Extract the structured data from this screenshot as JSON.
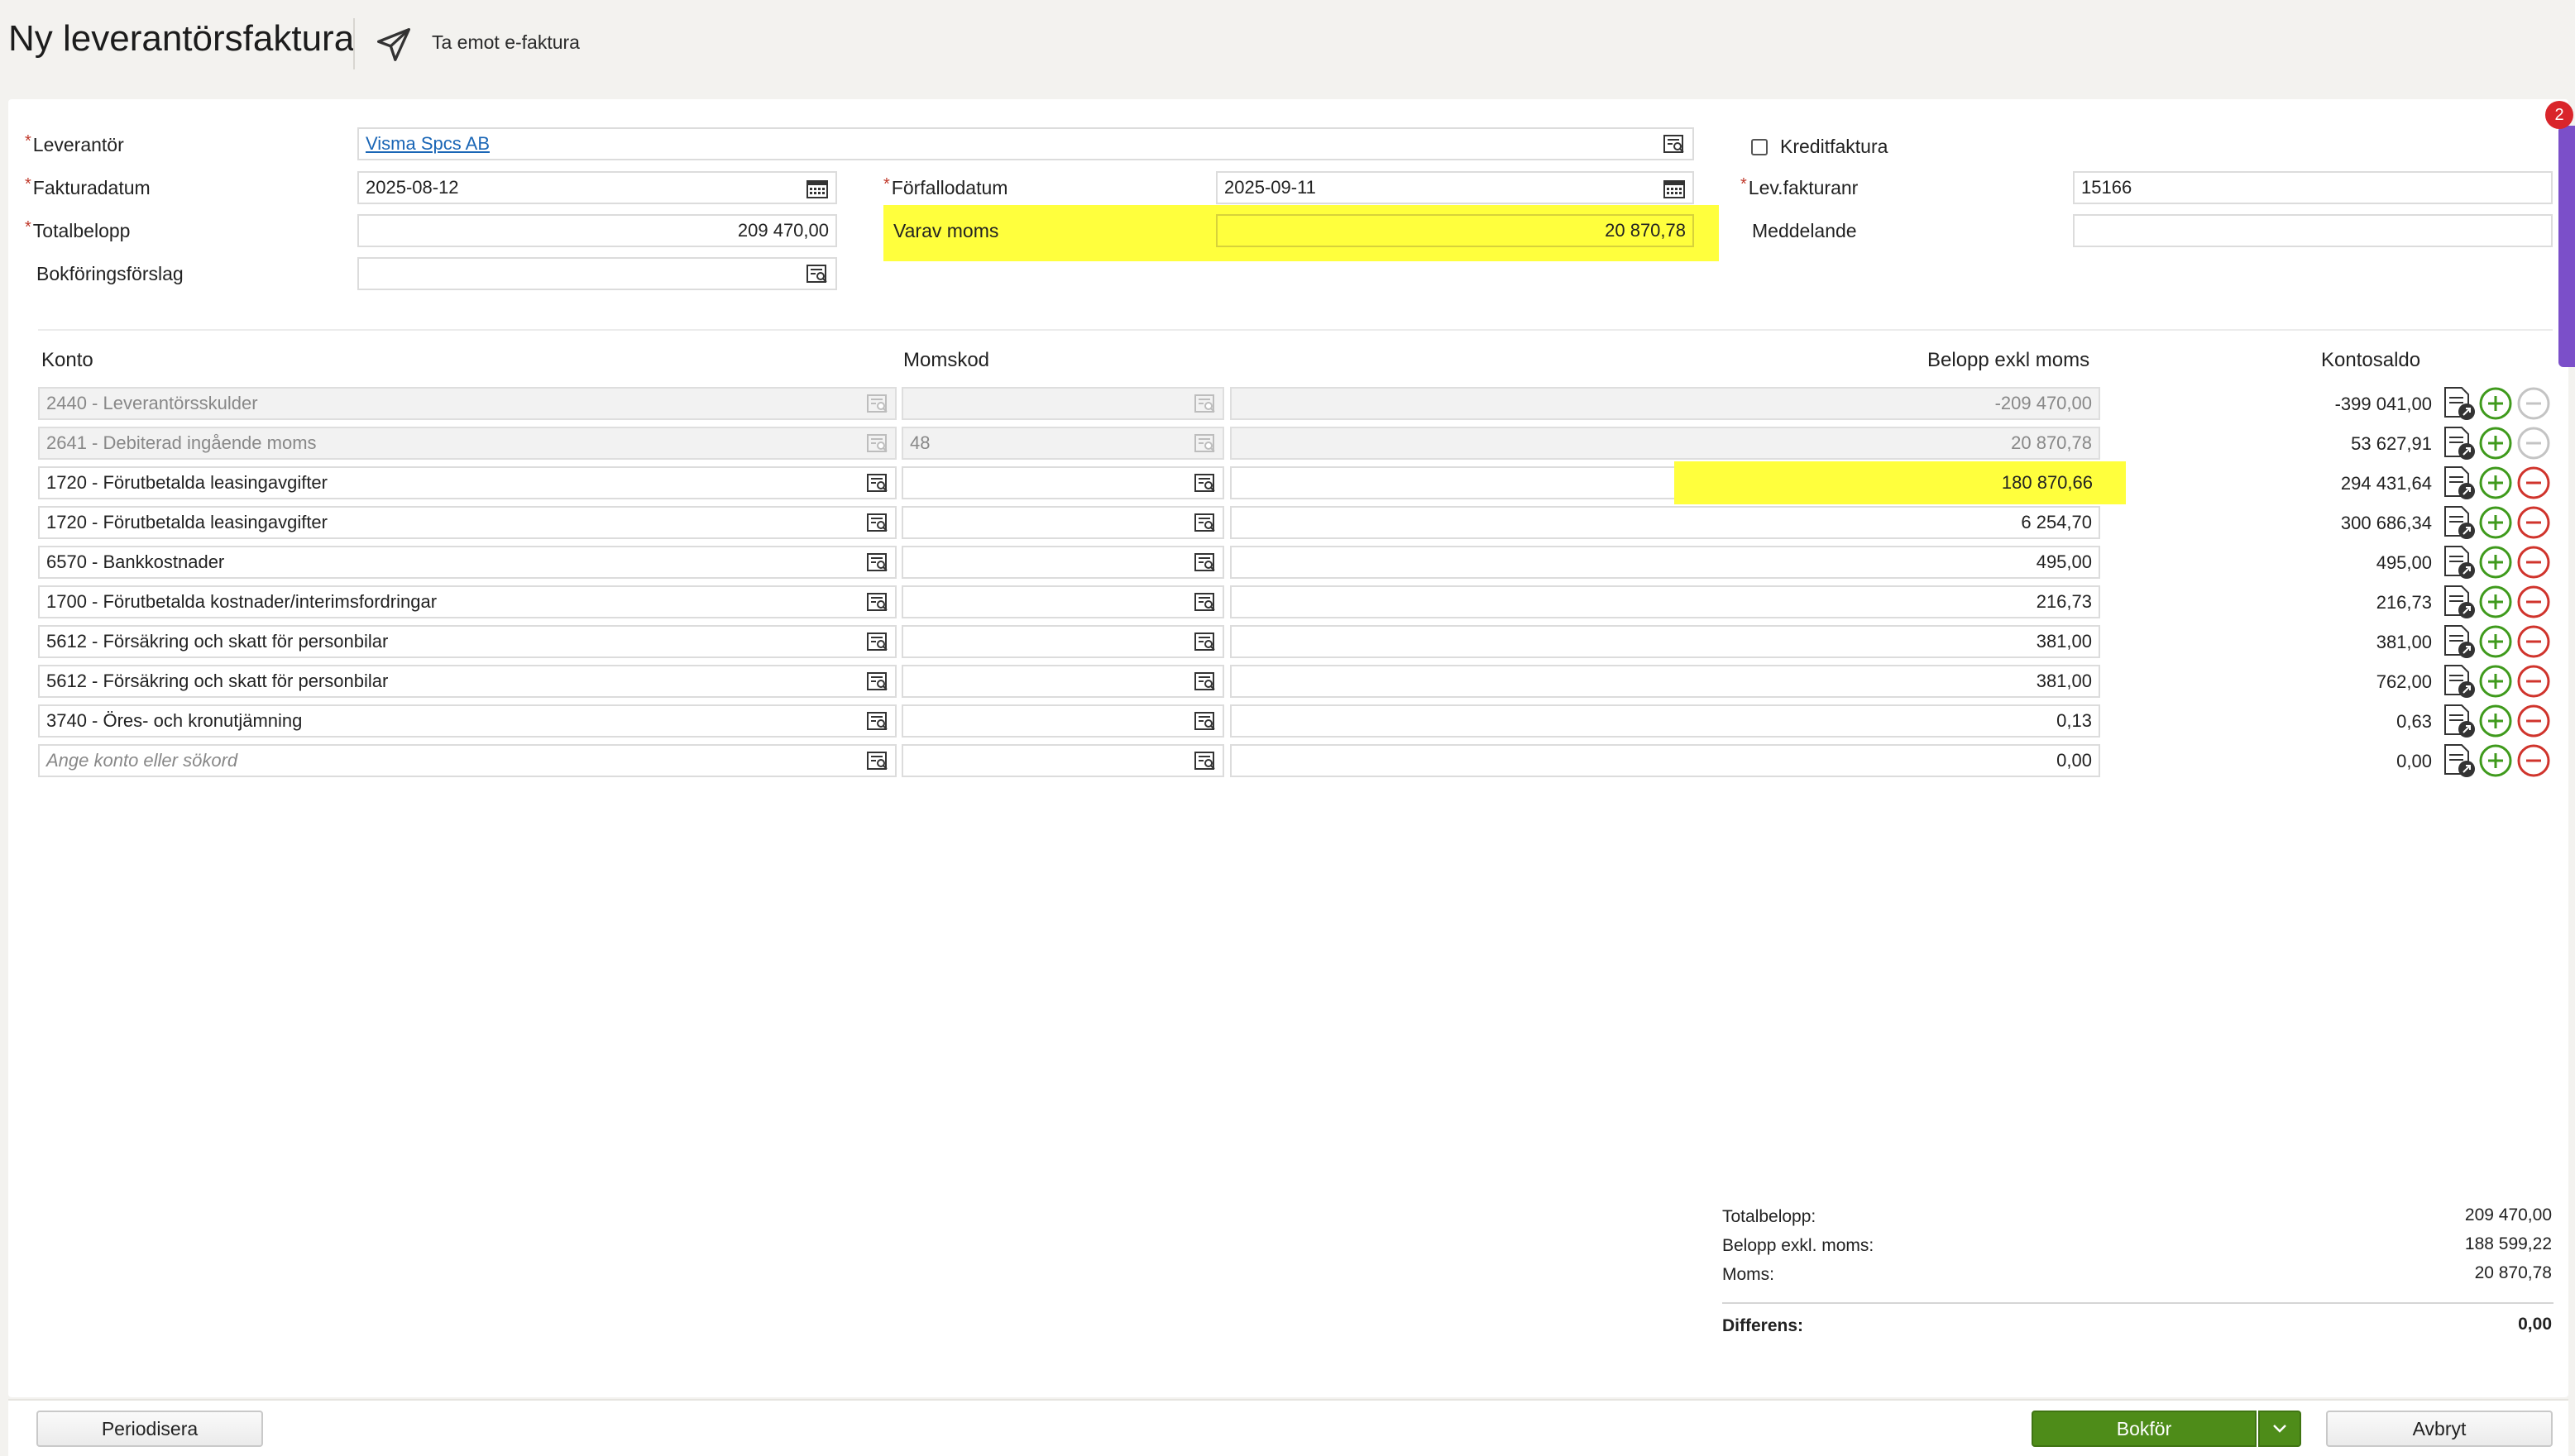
{
  "header": {
    "title": "Ny leverantörsfaktura",
    "receive_einvoice": "Ta emot e-faktura"
  },
  "form": {
    "supplier": {
      "label": "Leverantör",
      "value": "Visma Spcs AB"
    },
    "credit_invoice": {
      "label": "Kreditfaktura",
      "checked": false
    },
    "invoice_date": {
      "label": "Fakturadatum",
      "value": "2025-08-12"
    },
    "due_date": {
      "label": "Förfallodatum",
      "value": "2025-09-11"
    },
    "supplier_invoice_no": {
      "label": "Lev.fakturanr",
      "value": "15166"
    },
    "total_amount": {
      "label": "Totalbelopp",
      "value": "209 470,00"
    },
    "vat_amount": {
      "label": "Varav moms",
      "value": "20 870,78"
    },
    "message": {
      "label": "Meddelande",
      "value": ""
    },
    "booking_proposal": {
      "label": "Bokföringsförslag",
      "value": ""
    },
    "required_mark": "*"
  },
  "table": {
    "headers": {
      "account": "Konto",
      "vat_code": "Momskod",
      "amount_excl_vat": "Belopp exkl moms",
      "account_balance": "Kontosaldo"
    },
    "rows": [
      {
        "account": "2440 - Leverantörsskulder",
        "vat_code": "",
        "amount": "-209 470,00",
        "balance": "-399 041,00",
        "disabled": true
      },
      {
        "account": "2641 - Debiterad ingående moms",
        "vat_code": "48",
        "amount": "20 870,78",
        "balance": "53 627,91",
        "disabled": true
      },
      {
        "account": "1720 - Förutbetalda leasingavgifter",
        "vat_code": "",
        "amount": "180 870,66",
        "balance": "294 431,64",
        "disabled": false,
        "highlight": true
      },
      {
        "account": "1720 - Förutbetalda leasingavgifter",
        "vat_code": "",
        "amount": "6 254,70",
        "balance": "300 686,34",
        "disabled": false
      },
      {
        "account": "6570 - Bankkostnader",
        "vat_code": "",
        "amount": "495,00",
        "balance": "495,00",
        "disabled": false
      },
      {
        "account": "1700 - Förutbetalda kostnader/interimsfordringar",
        "vat_code": "",
        "amount": "216,73",
        "balance": "216,73",
        "disabled": false
      },
      {
        "account": "5612 - Försäkring och skatt för personbilar",
        "vat_code": "",
        "amount": "381,00",
        "balance": "381,00",
        "disabled": false
      },
      {
        "account": "5612 - Försäkring och skatt för personbilar",
        "vat_code": "",
        "amount": "381,00",
        "balance": "762,00",
        "disabled": false
      },
      {
        "account": "3740 - Öres- och kronutjämning",
        "vat_code": "",
        "amount": "0,13",
        "balance": "0,63",
        "disabled": false
      },
      {
        "account": "",
        "account_placeholder": "Ange konto eller sökord",
        "vat_code": "",
        "amount": "0,00",
        "balance": "0,00",
        "disabled": false,
        "placeholder": true
      }
    ]
  },
  "summary": {
    "total_label": "Totalbelopp:",
    "total_value": "209 470,00",
    "excl_label": "Belopp exkl. moms:",
    "excl_value": "188 599,22",
    "vat_label": "Moms:",
    "vat_value": "20 870,78",
    "diff_label": "Differens:",
    "diff_value": "0,00"
  },
  "footer": {
    "periodize": "Periodisera",
    "book": "Bokför",
    "cancel": "Avbryt"
  },
  "notification_badge": "2",
  "colors": {
    "highlight": "#ffff3d",
    "primary_green": "#4e8c19",
    "add_green": "#3f9a1c",
    "remove_red": "#d0342c",
    "link_blue": "#1a66b6",
    "side_tab_purple": "#7b4fc9",
    "badge_red": "#d9252b"
  }
}
